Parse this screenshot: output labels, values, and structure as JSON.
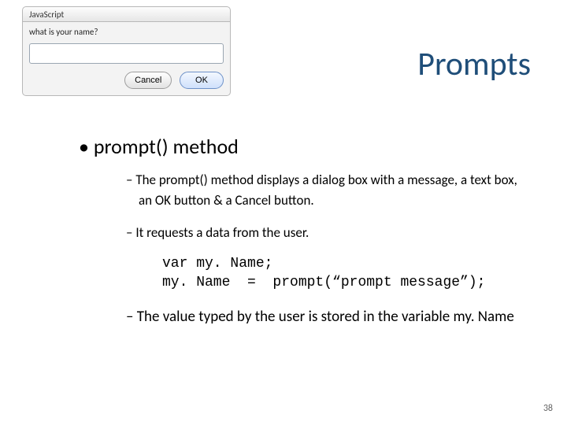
{
  "dialog": {
    "title": "JavaScript",
    "message": "what is your name?",
    "input_value": "",
    "cancel_label": "Cancel",
    "ok_label": "OK"
  },
  "slide": {
    "title": "Prompts",
    "bullet_l1": "prompt() method",
    "sub1": "The prompt() method displays a dialog box with a message, a text box, an OK button & a Cancel button.",
    "sub2": "It requests a data from the user.",
    "code_line1": "var my. Name;",
    "code_line2": "my. Name  =  prompt(“prompt message”);",
    "sub3": "The value typed by the user is stored in the variable my. Name",
    "page_number": "38"
  }
}
